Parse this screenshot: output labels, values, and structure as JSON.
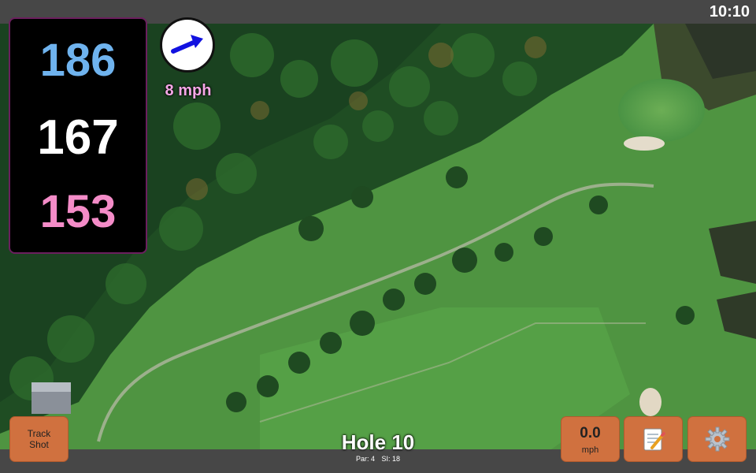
{
  "status": {
    "time": "10:10"
  },
  "distances": {
    "back": "186",
    "center": "167",
    "front": "153",
    "colors": {
      "back": "#6fb3ee",
      "center": "#ffffff",
      "front": "#f48cc8"
    }
  },
  "wind": {
    "speed_label": "8 mph",
    "label_color": "#f5a7e6",
    "arrow_icon": "wind-direction-arrow",
    "arrow_color": "#1212e0"
  },
  "hole": {
    "title": "Hole 10",
    "par": "Par: 4",
    "si": "SI: 18"
  },
  "buttons": {
    "track_shot": "Track\nShot",
    "speed_value": "0.0",
    "speed_unit": "mph",
    "notes_icon": "notepad-icon",
    "settings_icon": "gear-icon",
    "accent": "#d0713f"
  }
}
